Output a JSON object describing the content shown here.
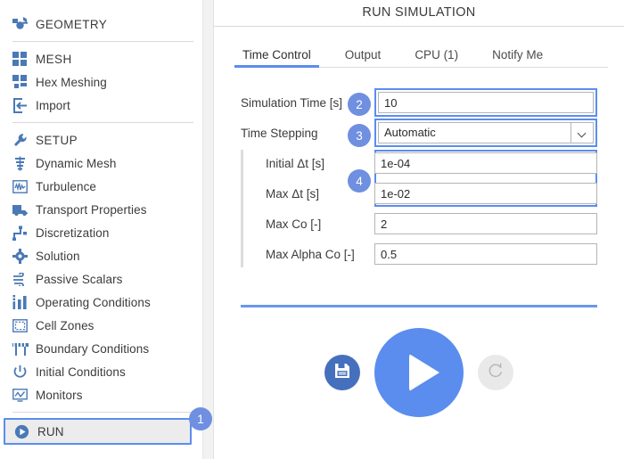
{
  "sidebar": {
    "groups": [
      {
        "items": [
          {
            "label": "GEOMETRY",
            "icon": "geometry-icon",
            "type": "header"
          }
        ]
      },
      {
        "items": [
          {
            "label": "MESH",
            "icon": "mesh-grid-icon",
            "type": "header"
          },
          {
            "label": "Hex Meshing",
            "icon": "hex-mesh-icon",
            "type": "item"
          },
          {
            "label": "Import",
            "icon": "import-icon",
            "type": "item"
          }
        ]
      },
      {
        "items": [
          {
            "label": "SETUP",
            "icon": "wrench-icon",
            "type": "header"
          },
          {
            "label": "Dynamic Mesh",
            "icon": "dynamic-mesh-icon",
            "type": "item"
          },
          {
            "label": "Turbulence",
            "icon": "turbulence-icon",
            "type": "item"
          },
          {
            "label": "Transport Properties",
            "icon": "truck-icon",
            "type": "item"
          },
          {
            "label": "Discretization",
            "icon": "discretization-icon",
            "type": "item"
          },
          {
            "label": "Solution",
            "icon": "gear-icon",
            "type": "item"
          },
          {
            "label": "Passive Scalars",
            "icon": "wind-icon",
            "type": "item"
          },
          {
            "label": "Operating Conditions",
            "icon": "bar-chart-icon",
            "type": "item"
          },
          {
            "label": "Cell Zones",
            "icon": "cell-zones-icon",
            "type": "item"
          },
          {
            "label": "Boundary Conditions",
            "icon": "barrier-icon",
            "type": "item"
          },
          {
            "label": "Initial Conditions",
            "icon": "power-icon",
            "type": "item"
          },
          {
            "label": "Monitors",
            "icon": "monitor-chart-icon",
            "type": "item"
          }
        ]
      },
      {
        "items": [
          {
            "label": "RUN",
            "icon": "play-circle-icon",
            "type": "selected"
          }
        ]
      }
    ]
  },
  "main": {
    "title": "RUN SIMULATION",
    "tabs": [
      {
        "label": "Time Control",
        "active": true
      },
      {
        "label": "Output",
        "active": false
      },
      {
        "label": "CPU  (1)",
        "active": false
      },
      {
        "label": "Notify Me",
        "active": false
      }
    ],
    "fields": {
      "simulation_time": {
        "label": "Simulation Time [s]",
        "value": "10"
      },
      "time_stepping": {
        "label": "Time Stepping",
        "value": "Automatic"
      },
      "initial_dt": {
        "label": "Initial Δt [s]",
        "value": "1e-04"
      },
      "max_dt": {
        "label": "Max Δt [s]",
        "value": "1e-02"
      },
      "max_co": {
        "label": "Max Co [-]",
        "value": "2"
      },
      "max_alpha_co": {
        "label": "Max Alpha Co [-]",
        "value": "0.5"
      }
    },
    "actions": {
      "save": "save-icon",
      "play": "play-icon",
      "reset": "reset-icon"
    }
  },
  "annotations": [
    {
      "number": "1",
      "target": "sidebar-item-run"
    },
    {
      "number": "2",
      "target": "simulation-time-field"
    },
    {
      "number": "3",
      "target": "time-stepping-select"
    },
    {
      "number": "4",
      "target": "delta-t-group"
    }
  ],
  "colors": {
    "accent": "#5b8def",
    "badge": "#6f8fe0",
    "icon": "#4a79b5",
    "save_button": "#4570bd",
    "reset_button": "#e9e9e9"
  }
}
